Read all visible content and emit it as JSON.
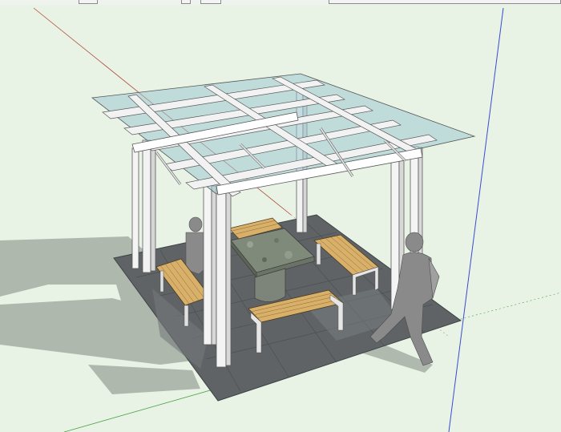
{
  "app": {
    "view_background": "#e8f3e6"
  },
  "axes": {
    "red": "#b04a3a",
    "green": "#4aa34a",
    "blue": "#3a4ad0"
  },
  "scene": {
    "ground_color": "#5f6365",
    "shadow_color": "#a9b2a7",
    "frame_color": "#f2f2f2",
    "roof_glass_color": "#9fc8cf",
    "bench_wood_color": "#d8b06a",
    "table_stone_color": "#7f8a7a",
    "figure_color": "#8a8a8a"
  },
  "toolbar": {
    "visible_fragments": [
      "tool-button-fragment",
      "tool-button-fragment",
      "tool-button-fragment"
    ]
  }
}
